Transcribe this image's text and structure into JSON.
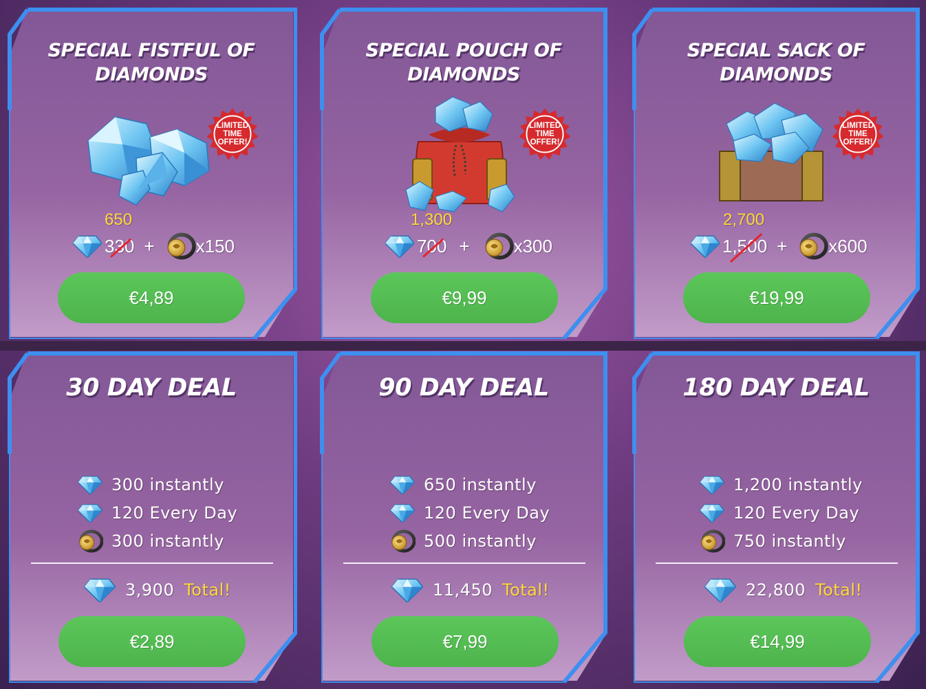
{
  "theme": {
    "accent_green": "#56bf54",
    "frame_blue": "#3d8ff0",
    "highlight_yellow": "#ffd83a",
    "strike_red": "#e2232e"
  },
  "offers": [
    {
      "title_line1": "SPECIAL FISTFUL OF",
      "title_line2": "DIAMONDS",
      "badge_line1": "LIMITED",
      "badge_line2": "TIME",
      "badge_line3": "OFFER!",
      "new_amount": "650",
      "old_amount": "330",
      "plus": "+",
      "bonus": "x150",
      "price": "€4,89",
      "image": "diamond-pile"
    },
    {
      "title_line1": "SPECIAL POUCH OF",
      "title_line2": "DIAMONDS",
      "badge_line1": "LIMITED",
      "badge_line2": "TIME",
      "badge_line3": "OFFER!",
      "new_amount": "1,300",
      "old_amount": "700",
      "plus": "+",
      "bonus": "x300",
      "price": "€9,99",
      "image": "diamond-pouch"
    },
    {
      "title_line1": "SPECIAL SACK OF",
      "title_line2": "DIAMONDS",
      "badge_line1": "LIMITED",
      "badge_line2": "TIME",
      "badge_line3": "OFFER!",
      "new_amount": "2,700",
      "old_amount": "1,500",
      "plus": "+",
      "bonus": "x600",
      "price": "€19,99",
      "image": "diamond-crate"
    }
  ],
  "deals": [
    {
      "title": "30 DAY DEAL",
      "row1": "300 instantly",
      "row2": "120 Every Day",
      "row3": "300 instantly",
      "total_value": "3,900",
      "total_label": "Total!",
      "price": "€2,89"
    },
    {
      "title": "90 DAY DEAL",
      "row1": "650 instantly",
      "row2": "120 Every Day",
      "row3": "500 instantly",
      "total_value": "11,450",
      "total_label": "Total!",
      "price": "€7,99"
    },
    {
      "title": "180 DAY DEAL",
      "row1": "1,200 instantly",
      "row2": "120 Every Day",
      "row3": "750 instantly",
      "total_value": "22,800",
      "total_label": "Total!",
      "price": "€14,99"
    }
  ],
  "icons": {
    "diamond": "diamond-icon",
    "ring": "gold-ring-icon",
    "badge": "starburst-badge-icon"
  }
}
